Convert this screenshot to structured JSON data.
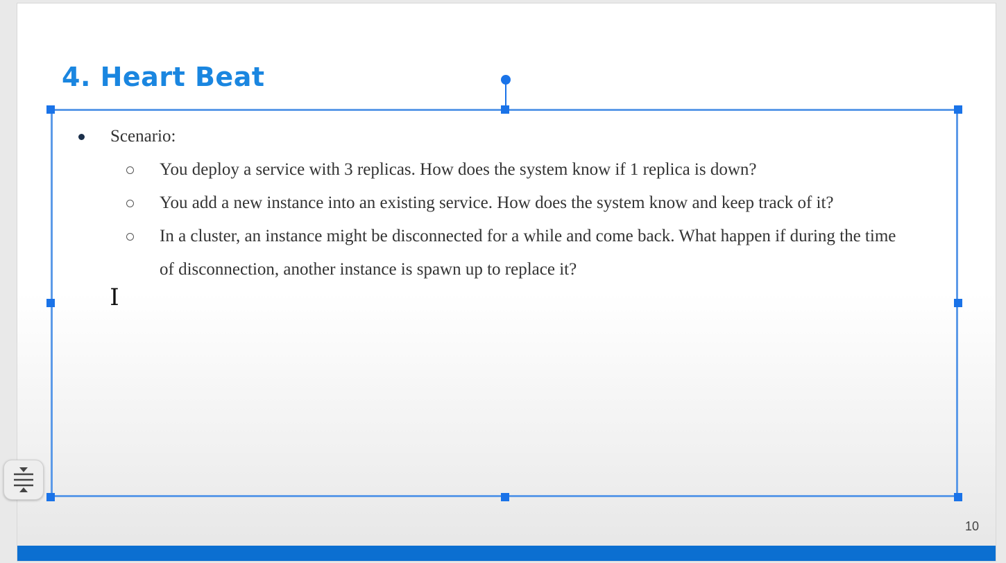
{
  "slide": {
    "title": "4. Heart Beat",
    "page_number": "10",
    "title_color": "#1a86e0",
    "accent_color": "#0b6fd1",
    "selection_color": "#1a73e8"
  },
  "content": {
    "heading": "Scenario:",
    "items": [
      "You deploy a service with 3 replicas. How does the system know if 1 replica is down?",
      "You add a new instance into an existing service. How does the system know and keep track of it?",
      "In a cluster, an instance might be disconnected for a while and come back. What happen if during the time of disconnection, another instance is spawn up to replace it?"
    ]
  },
  "icons": {
    "cursor": "text-cursor-icon",
    "fold": "collapse-vertical-icon"
  }
}
